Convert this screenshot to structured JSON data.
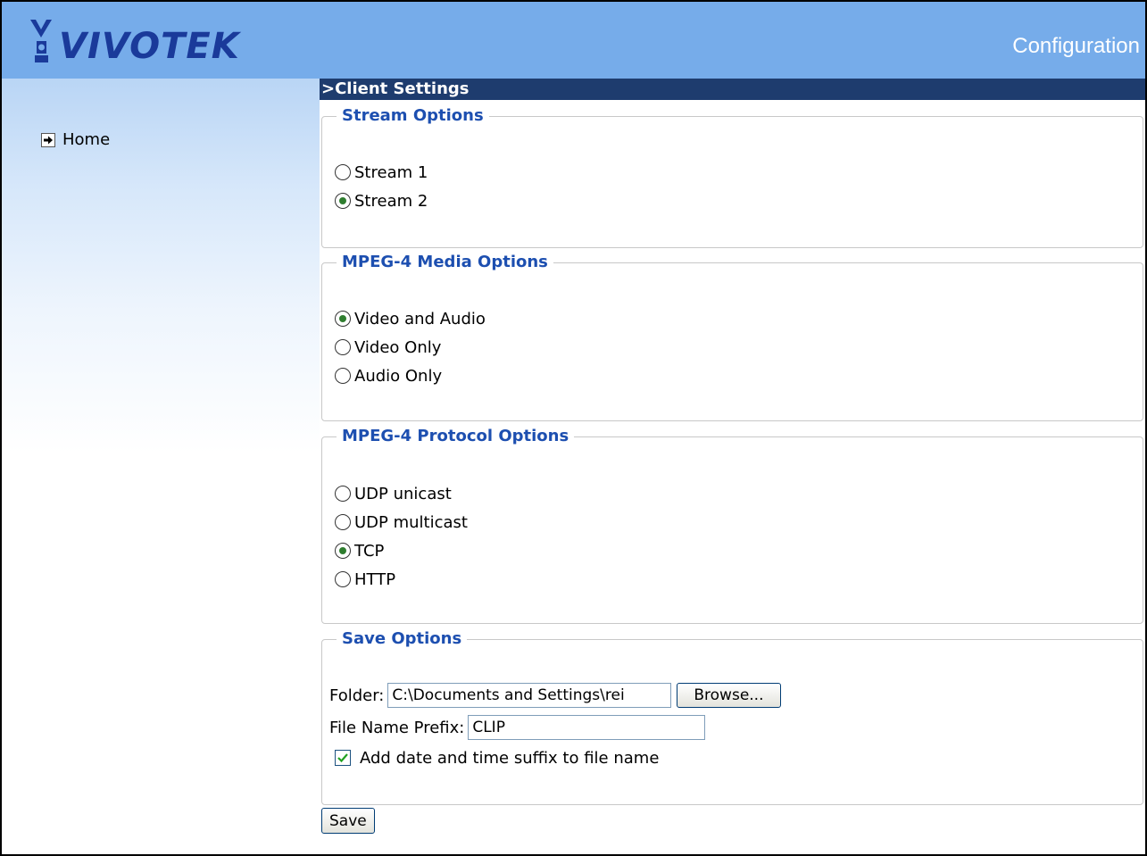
{
  "header": {
    "logo_text": "VIVOTEK",
    "page_title": "Configuration"
  },
  "sidebar": {
    "home_label": "Home"
  },
  "section": {
    "title": ">Client Settings"
  },
  "stream_options": {
    "legend": "Stream Options",
    "options": [
      {
        "label": "Stream 1",
        "checked": false
      },
      {
        "label": "Stream 2",
        "checked": true
      }
    ]
  },
  "media_options": {
    "legend": "MPEG-4 Media Options",
    "options": [
      {
        "label": "Video and Audio",
        "checked": true
      },
      {
        "label": "Video Only",
        "checked": false
      },
      {
        "label": "Audio Only",
        "checked": false
      }
    ]
  },
  "protocol_options": {
    "legend": "MPEG-4 Protocol Options",
    "options": [
      {
        "label": "UDP unicast",
        "checked": false
      },
      {
        "label": "UDP multicast",
        "checked": false
      },
      {
        "label": "TCP",
        "checked": true
      },
      {
        "label": "HTTP",
        "checked": false
      }
    ]
  },
  "save_options": {
    "legend": "Save Options",
    "folder_label": "Folder:",
    "folder_value": "C:\\Documents and Settings\\rei",
    "browse_label": "Browse...",
    "prefix_label": "File Name Prefix:",
    "prefix_value": "CLIP",
    "suffix_label": "Add date and time suffix to file name",
    "suffix_checked": true
  },
  "save_button_label": "Save",
  "colors": {
    "header_bg": "#76acea",
    "section_bar": "#1e3c6e",
    "legend_text": "#1d4fb0",
    "radio_dot": "#2f7d2f"
  }
}
